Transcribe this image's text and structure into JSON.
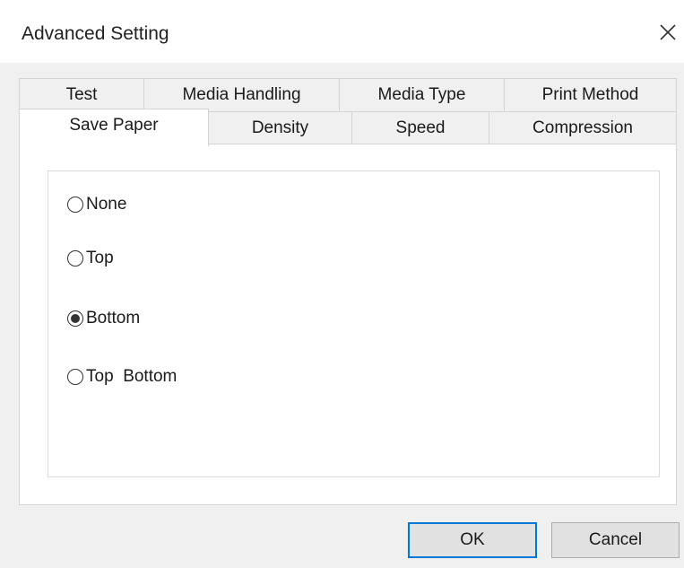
{
  "window": {
    "title": "Advanced Setting",
    "close_glyph": "×"
  },
  "tabs": {
    "row1": [
      "Test",
      "Media Handling",
      "Media Type",
      "Print Method"
    ],
    "row2": [
      "Save Paper",
      "Density",
      "Speed",
      "Compression"
    ],
    "selected": "Save Paper"
  },
  "options": {
    "items": [
      {
        "label": "None",
        "checked": false
      },
      {
        "label": "Top",
        "checked": false
      },
      {
        "label": "Bottom",
        "checked": true
      },
      {
        "label": "Top  Bottom",
        "checked": false
      }
    ]
  },
  "buttons": {
    "ok": "OK",
    "cancel": "Cancel"
  },
  "colors": {
    "default_button_border": "#0078d7",
    "client_background": "#f0f0f0"
  },
  "icons": {
    "close": "close-icon"
  }
}
